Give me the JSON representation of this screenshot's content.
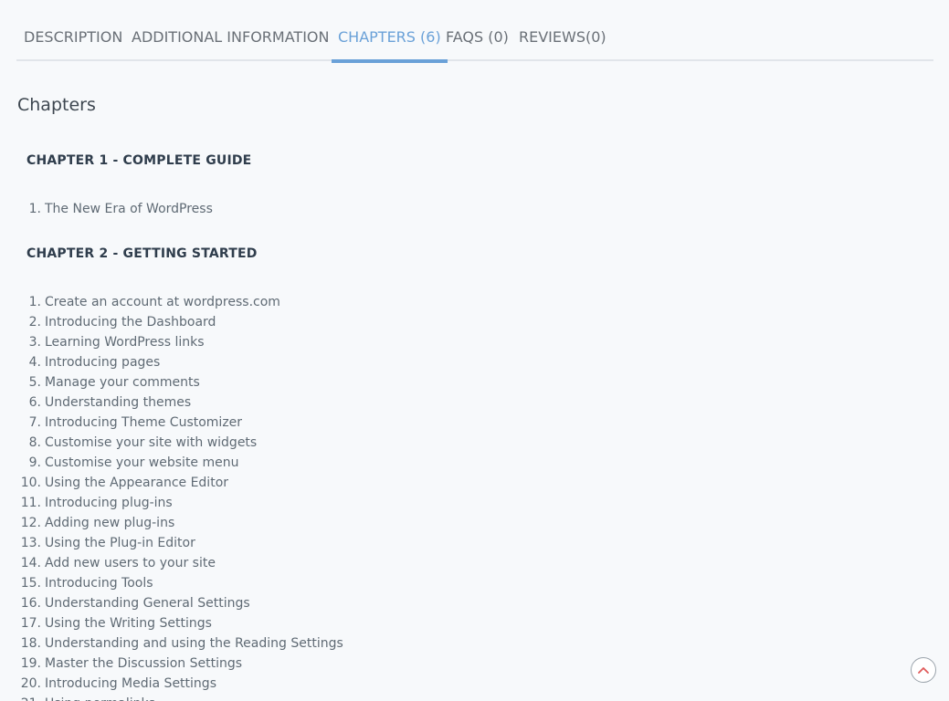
{
  "tabs": [
    {
      "label": "DESCRIPTION",
      "active": false
    },
    {
      "label": "ADDITIONAL INFORMATION",
      "active": false
    },
    {
      "label": "CHAPTERS (6)",
      "active": true
    },
    {
      "label": "FAQS (0)",
      "active": false
    },
    {
      "label": "REVIEWS(0)",
      "active": false
    }
  ],
  "section_title": "Chapters",
  "chapters": [
    {
      "title": "CHAPTER 1 - COMPLETE GUIDE",
      "items": [
        "The New Era of WordPress"
      ]
    },
    {
      "title": "CHAPTER 2 - GETTING STARTED",
      "items": [
        "Create an account at wordpress.com",
        "Introducing the Dashboard",
        "Learning WordPress links",
        "Introducing pages",
        "Manage your comments",
        "Understanding themes",
        "Introducing Theme Customizer",
        "Customise your site with widgets",
        "Customise your website menu",
        "Using the Appearance Editor",
        "Introducing plug-ins",
        "Adding new plug-ins",
        "Using the Plug-in Editor",
        "Add new users to your site",
        "Introducing Tools",
        "Understanding General Settings",
        "Using the Writing Settings",
        "Understanding and using the Reading Settings",
        "Master the Discussion Settings",
        "Introducing Media Settings",
        "Using permalinks"
      ]
    }
  ],
  "scroll_top_icon": "chevron-up-icon",
  "colors": {
    "accent": "#6aa1d8",
    "heading": "#2f3d4c",
    "text": "#5f6a74",
    "background": "#f7f9fb"
  }
}
